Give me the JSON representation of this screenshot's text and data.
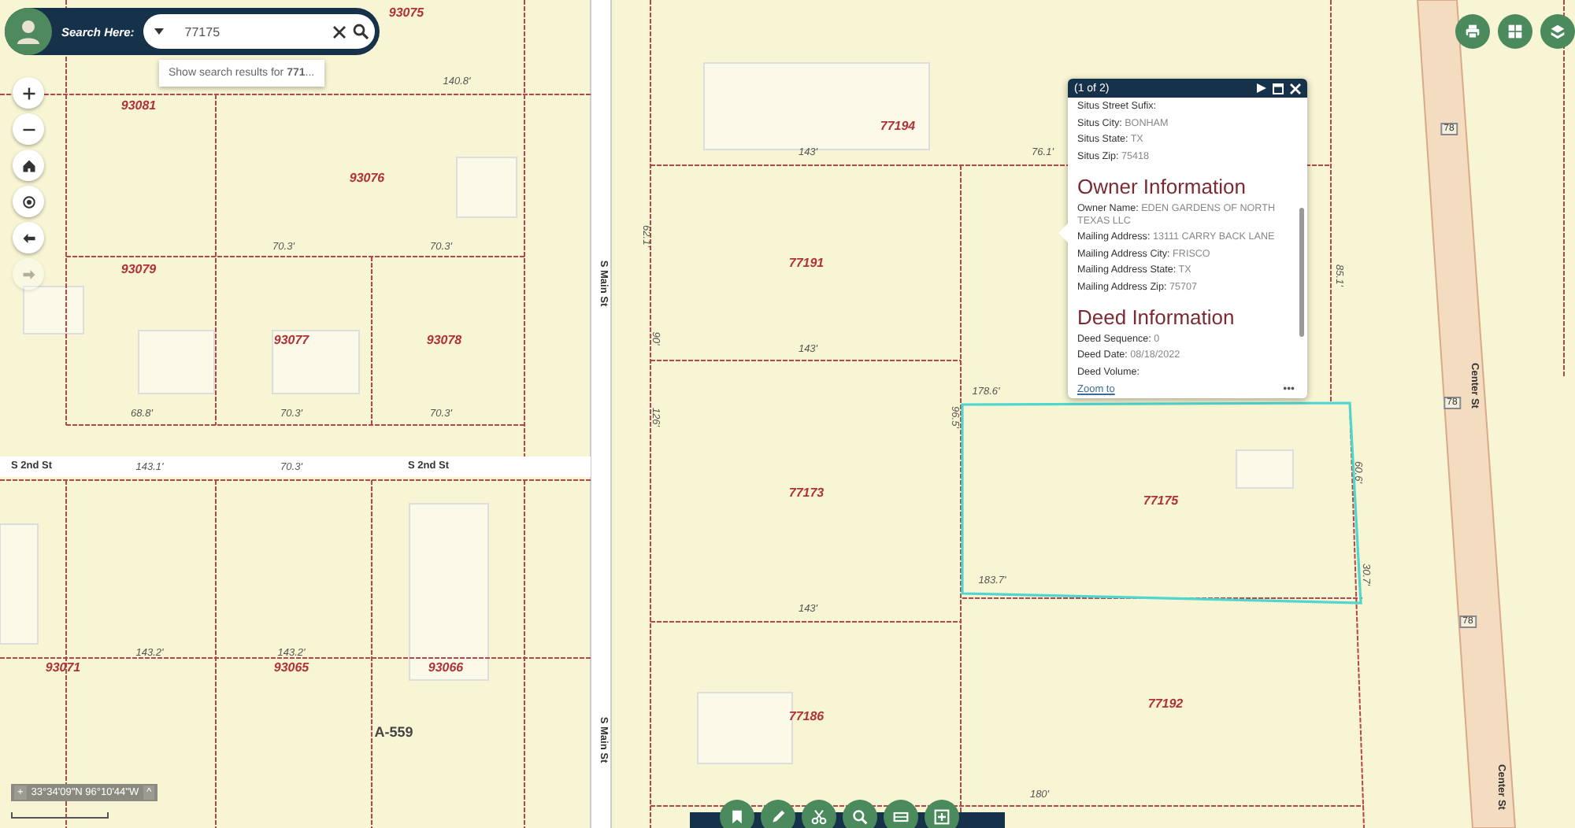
{
  "search": {
    "label": "Search Here:",
    "value": "77175",
    "suggestion": "Show search results for **771**..."
  },
  "nav_buttons": [
    {
      "kind": "zoom-in",
      "disabled": false
    },
    {
      "kind": "zoom-out",
      "disabled": false
    },
    {
      "kind": "home",
      "disabled": false
    },
    {
      "kind": "locate",
      "disabled": false
    },
    {
      "kind": "back",
      "disabled": false
    },
    {
      "kind": "forward",
      "disabled": true
    }
  ],
  "top_buttons": [
    {
      "kind": "print"
    },
    {
      "kind": "basemap"
    },
    {
      "kind": "layers"
    }
  ],
  "map": {
    "parcel_labels": [
      "93075",
      "93081",
      "93076",
      "93079",
      "93077",
      "93078",
      "77194",
      "77191",
      "77173",
      "77175",
      "77192",
      "77186",
      "93071",
      "93065",
      "93066",
      "A-559"
    ],
    "street_labels": [
      "S Main St",
      "S Main St",
      "S 2nd St",
      "S 2nd St",
      "Center St",
      "Center St"
    ],
    "route_shields": [
      "78",
      "78",
      "78"
    ],
    "dimension_labels": [
      "140.8'",
      "70.3'",
      "70.3'",
      "68.8'",
      "70.3'",
      "70.3'",
      "143.1'",
      "70.3'",
      "143.2'",
      "143.2'",
      "143'",
      "76.1'",
      "143'",
      "178.6'",
      "183.7'",
      "143'",
      "180'",
      "62.1'",
      "90'",
      "126'",
      "85.1'",
      "60.6'",
      "30.7'",
      "96.5'"
    ]
  },
  "popup": {
    "title": "(1 of 2)",
    "rows": [
      {
        "kind": "field",
        "label": "Situs Street Sufix:"
      },
      {
        "kind": "field",
        "label": "Situs City:",
        "value": "BONHAM"
      },
      {
        "kind": "field",
        "label": "Situs State:",
        "value": "TX"
      },
      {
        "kind": "field",
        "label": "Situs Zip:",
        "value": "75418"
      },
      {
        "kind": "heading",
        "label": "Owner Information"
      },
      {
        "kind": "field",
        "label": "Owner Name:",
        "value": "EDEN GARDENS OF NORTH TEXAS LLC"
      },
      {
        "kind": "field",
        "label": "Mailing Address:",
        "value": "13111 CARRY BACK LANE"
      },
      {
        "kind": "field",
        "label": "Mailing Address City:",
        "value": "FRISCO"
      },
      {
        "kind": "field",
        "label": "Mailing Address State:",
        "value": "TX"
      },
      {
        "kind": "field",
        "label": "Mailing Address Zip:",
        "value": "75707"
      },
      {
        "kind": "heading",
        "label": "Deed Information"
      },
      {
        "kind": "field",
        "label": "Deed Sequence:",
        "value": "0"
      },
      {
        "kind": "field",
        "label": "Deed Date:",
        "value": "08/18/2022"
      },
      {
        "kind": "field",
        "label": "Deed Volume:"
      }
    ],
    "link": "Zoom to",
    "more": "•••"
  },
  "coordinates": {
    "expand": "+",
    "text": "33°34'09\"N 96°10'44\"W",
    "collapse": "^"
  },
  "toolbar": [
    {
      "kind": "bookmark"
    },
    {
      "kind": "edit"
    },
    {
      "kind": "measure"
    },
    {
      "kind": "zoom-search"
    },
    {
      "kind": "table"
    },
    {
      "kind": "add"
    }
  ]
}
